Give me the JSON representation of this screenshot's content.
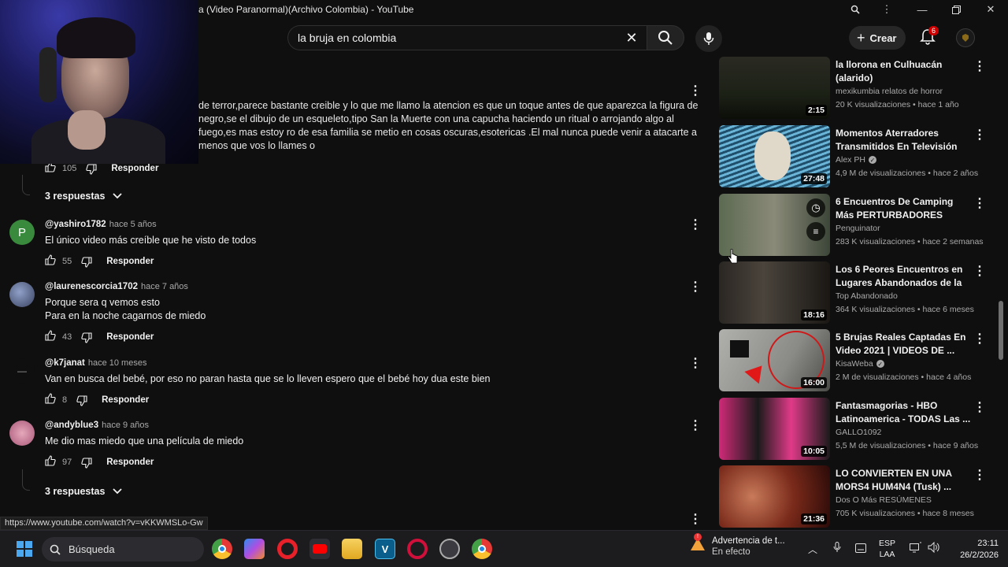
{
  "window": {
    "title": "a (Video Paranormal)(Archivo Colombia) - YouTube",
    "controls": [
      "zoom-icon",
      "menu-icon",
      "minimize-icon",
      "restore-icon",
      "close-icon"
    ]
  },
  "masthead": {
    "search_value": "la bruja en colombia",
    "create_label": "Crear",
    "notification_count": "6",
    "icons": [
      "search-icon",
      "clear-icon",
      "mic-icon",
      "bell-icon",
      "plus-icon"
    ]
  },
  "top_comment": {
    "text": "de terror,parece bastante creible y lo que me llamo la atencion es que un toque antes de que aparezca la figura de negro,se el dibujo de un esqueleto,tipo San la Muerte con una capucha haciendo un ritual o arrojando algo al fuego,es mas estoy ro de esa familia se metio en cosas oscuras,esotericas .El mal nunca puede venir a atacarte a menos que vos lo llames o",
    "likes": "105",
    "reply_label": "Responder",
    "replies_label": "3 respuestas"
  },
  "comments": [
    {
      "avatar_letter": "P",
      "avatar_color": "#3a8a3e",
      "author": "@yashiro1782",
      "time": "hace 5 años",
      "lines": [
        "El único  video  más creíble que he visto de todos"
      ],
      "likes": "55",
      "reply_label": "Responder"
    },
    {
      "avatar_letter": "",
      "avatar_color": "#5a6a8a",
      "author": "@laurenescorcia1702",
      "time": "hace 7 años",
      "lines": [
        "Porque sera q vemos esto",
        "Para en la noche cagarnos de miedo"
      ],
      "likes": "43",
      "reply_label": "Responder"
    },
    {
      "avatar_letter": "—",
      "avatar_color": "#0f0f0f",
      "author": "@k7janat",
      "time": "hace 10 meses",
      "lines": [
        "Van en busca del bebé, por eso no paran hasta que se lo lleven espero que el bebé hoy dua este bien"
      ],
      "likes": "8",
      "reply_label": "Responder"
    },
    {
      "avatar_letter": "",
      "avatar_color": "#c98aa0",
      "author": "@andyblue3",
      "time": "hace 9 años",
      "lines": [
        "Me dio mas miedo que una película de miedo"
      ],
      "likes": "97",
      "reply_label": "Responder"
    }
  ],
  "bottom_replies_label": "3 respuestas",
  "related": [
    {
      "title": "la llorona en Culhuacán (alarido)",
      "channel": "mexikumbia relatos de horror",
      "verified": false,
      "meta": "20 K visualizaciones • hace 1 año",
      "duration": "2:15",
      "thumb_color": "#1c2116"
    },
    {
      "title": "Momentos Aterradores Transmitidos En Televisión",
      "channel": "Alex PH",
      "verified": true,
      "meta": "4,9 M de visualizaciones • hace 2 años",
      "duration": "27:48",
      "thumb_color": "#2a5a78"
    },
    {
      "title": "6 Encuentros De Camping Más PERTURBADORES",
      "channel": "Penguinator",
      "verified": false,
      "meta": "283 K visualizaciones • hace 2 semanas",
      "duration": "",
      "thumb_color": "#4a5a48"
    },
    {
      "title": "Los 6 Peores Encuentros en Lugares Abandonados de la ...",
      "channel": "Top Abandonado",
      "verified": false,
      "meta": "364 K visualizaciones • hace 6 meses",
      "duration": "18:16",
      "thumb_color": "#3a3632"
    },
    {
      "title": "5 Brujas Reales Captadas En Video 2021 | VIDEOS DE ...",
      "channel": "KisaWeba",
      "verified": true,
      "meta": "2 M de visualizaciones • hace 4 años",
      "duration": "16:00",
      "thumb_color": "#8a8a88"
    },
    {
      "title": "Fantasmagorias - HBO Latinoamerica - TODAS Las ...",
      "channel": "GALLO1092",
      "verified": false,
      "meta": "5,5 M de visualizaciones • hace 9 años",
      "duration": "10:05",
      "thumb_color": "#c02a6a"
    },
    {
      "title": "LO CONVIERTEN EN UNA MORS4 HUM4N4 (Tusk) ...",
      "channel": "Dos O Más RESÚMENES",
      "verified": false,
      "meta": "705 K visualizaciones • hace 8 meses",
      "duration": "21:36",
      "thumb_color": "#6a1a14"
    }
  ],
  "status_url": "https://www.youtube.com/watch?v=vKKWMSLo-Gw",
  "taskbar": {
    "search_placeholder": "Búsqueda",
    "apps": [
      "chrome-icon",
      "copilot-icon",
      "opera-icon",
      "youtube-icon",
      "files-icon",
      "v-app-icon",
      "opera-gx-icon",
      "settings-icon",
      "chrome-profile-icon"
    ],
    "notification_title": "Advertencia de t...",
    "notification_sub": "En efecto",
    "lang_top": "ESP",
    "lang_bottom": "LAA",
    "time": "23:11",
    "date": "26/2/2026"
  }
}
